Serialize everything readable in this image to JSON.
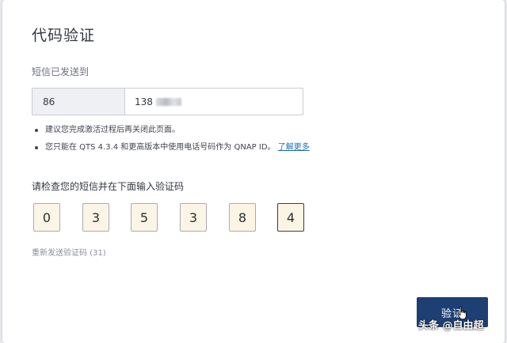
{
  "dialog": {
    "title": "代码验证",
    "sent_label": "短信已发送到",
    "phone": {
      "country_code": "86",
      "number_prefix": "138"
    },
    "notes": [
      {
        "text": "建议您完成激活过程后再关闭此页面。",
        "link": ""
      },
      {
        "text": "您只能在 QTS 4.3.4 和更高版本中使用电话号码作为 QNAP ID。",
        "link": "了解更多"
      }
    ],
    "check_label": "请检查您的短信并在下面输入验证码",
    "code_digits": [
      "0",
      "3",
      "5",
      "3",
      "8",
      "4"
    ],
    "resend_label": "重新发送验证码 (31)",
    "verify_label": "验证"
  },
  "watermark": "头条 @自由超",
  "colors": {
    "primary_button": "#1e3f73",
    "digit_box_bg": "#fcf5e6",
    "link": "#1f6fb8"
  }
}
